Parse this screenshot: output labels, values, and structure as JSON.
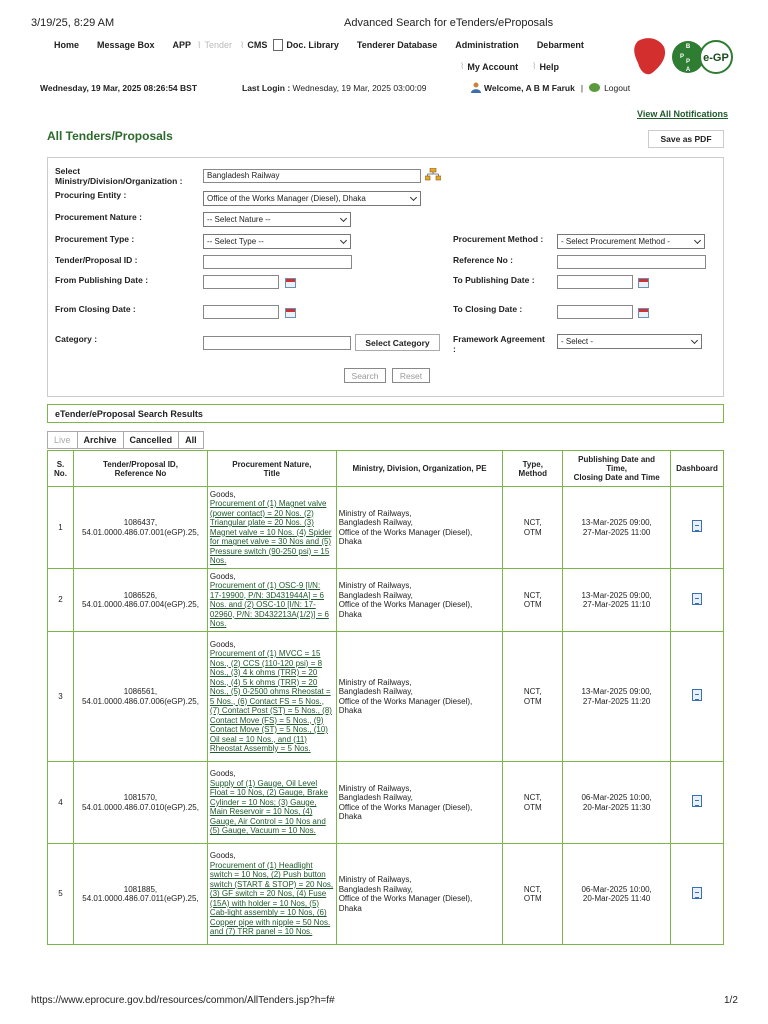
{
  "print": {
    "date": "3/19/25, 8:29 AM",
    "title": "Advanced Search for eTenders/eProposals",
    "url": "https://www.eprocure.gov.bd/resources/common/AllTenders.jsp?h=f#",
    "page": "1/2"
  },
  "nav": {
    "items": [
      "Home",
      "Message Box",
      "APP",
      "Tender",
      "CMS",
      "Doc. Library",
      "Tenderer Database",
      "Administration",
      "Debarment"
    ],
    "my_account": "My Account",
    "help": "Help"
  },
  "logo": {
    "text": "e-GP",
    "badge": "BPPA"
  },
  "status": {
    "datetime": "Wednesday, 19 Mar, 2025 08:26:54 BST",
    "last_login_label": "Last Login :",
    "last_login_value": "Wednesday, 19 Mar, 2025 03:00:09",
    "welcome": "Welcome, A B M Faruk",
    "logout": "Logout"
  },
  "links": {
    "view_all": "View All Notifications"
  },
  "page": {
    "title": "All Tenders/Proposals",
    "save_pdf": "Save as PDF"
  },
  "form": {
    "ministry_label_1": "Select",
    "ministry_label_2": "Ministry/Division/Organization :",
    "ministry_value": "Bangladesh Railway",
    "pe_label": "Procuring Entity :",
    "pe_value": "Office of the Works Manager (Diesel), Dhaka",
    "nature_label": "Procurement Nature :",
    "nature_value": "-- Select Nature --",
    "type_label": "Procurement Type :",
    "type_value": "-- Select Type --",
    "method_label": "Procurement Method :",
    "method_value": "- Select Procurement Method -",
    "tender_id_label": "Tender/Proposal ID :",
    "ref_label": "Reference No :",
    "from_pub_label": "From Publishing Date :",
    "to_pub_label": "To Publishing Date :",
    "from_close_label": "From Closing Date :",
    "to_close_label": "To Closing Date :",
    "category_label": "Category :",
    "select_category": "Select Category",
    "framework_label_1": "Framework Agreement",
    "framework_label_2": ":",
    "framework_value": "- Select -",
    "search": "Search",
    "reset": "Reset"
  },
  "results": {
    "title": "eTender/eProposal Search Results",
    "tabs": [
      "Live",
      "Archive",
      "Cancelled",
      "All"
    ],
    "headers": {
      "sno_1": "S.",
      "sno_2": "No.",
      "id_1": "Tender/Proposal ID,",
      "id_2": "Reference No",
      "nature_1": "Procurement Nature,",
      "nature_2": "Title",
      "ministry": "Ministry, Division, Organization, PE",
      "type_1": "Type,",
      "type_2": "Method",
      "dates_1": "Publishing Date and",
      "dates_2": "Time,",
      "dates_3": "Closing Date and Time",
      "dashboard": "Dashboard"
    },
    "rows": [
      {
        "sno": "1",
        "id": "1086437,",
        "ref": "54.01.0000.486.07.001(eGP).25,",
        "nature": "Goods,",
        "title": "Procurement of (1) Magnet valve (power contact) = 20 Nos. (2) Triangular plate = 20 Nos. (3) Magnet valve = 10 Nos. (4) Spider for magnet valve = 30 Nos and (5) Pressure switch (90-250 psi) = 15 Nos.",
        "min_1": "Ministry of Railways,",
        "min_2": "Bangladesh Railway,",
        "min_3": "Office of the Works Manager (Diesel),",
        "min_4": "Dhaka",
        "type": "NCT,",
        "method": "OTM",
        "pub": "13-Mar-2025 09:00,",
        "close": "27-Mar-2025 11:00"
      },
      {
        "sno": "2",
        "id": "1086526,",
        "ref": "54.01.0000.486.07.004(eGP).25,",
        "nature": "Goods,",
        "title": "Procurement of (1) OSC-9 [I/N: 17-19900, P/N: 3D431944A] = 6 Nos. and (2) OSC-10 [I/N: 17-02960, P/N: 3D432213A(1/2)] = 6 Nos.",
        "min_1": "Ministry of Railways,",
        "min_2": "Bangladesh Railway,",
        "min_3": "Office of the Works Manager (Diesel),",
        "min_4": "Dhaka",
        "type": "NCT,",
        "method": "OTM",
        "pub": "13-Mar-2025 09:00,",
        "close": "27-Mar-2025 11:10"
      },
      {
        "sno": "3",
        "id": "1086561,",
        "ref": "54.01.0000.486.07.006(eGP).25,",
        "nature": "Goods,",
        "title": "Procurement of (1) MVCC = 15 Nos., (2) CCS (110-120 psi) = 8 Nos., (3) 4 k ohms (TRR) = 20 Nos., (4) 5 k ohms (TRR) = 20 Nos., (5) 0-2500 ohms Rheostat = 5 Nos., (6) Contact FS = 5 Nos., (7) Contact Post (ST) = 5 Nos., (8) Contact Move (FS) = 5 Nos., (9) Contact Move (ST) = 5 Nos., (10) Oil seal = 10 Nos., and (11) Rheostat Assembly = 5 Nos.",
        "min_1": "Ministry of Railways,",
        "min_2": "Bangladesh Railway,",
        "min_3": "Office of the Works Manager (Diesel),",
        "min_4": "Dhaka",
        "type": "NCT,",
        "method": "OTM",
        "pub": "13-Mar-2025 09:00,",
        "close": "27-Mar-2025 11:20"
      },
      {
        "sno": "4",
        "id": "1081570,",
        "ref": "54.01.0000.486.07.010(eGP).25,",
        "nature": "Goods,",
        "title": "Supply of (1) Gauge, Oil Level Float = 10 Nos, (2) Gauge, Brake Cylinder = 10 Nos; (3) Gauge, Main Reservoir = 10 Nos, (4) Gauge, Air Control = 10 Nos and (5) Gauge, Vacuum = 10 Nos.",
        "min_1": "Ministry of Railways,",
        "min_2": "Bangladesh Railway,",
        "min_3": "Office of the Works Manager (Diesel),",
        "min_4": "Dhaka",
        "type": "NCT,",
        "method": "OTM",
        "pub": "06-Mar-2025 10:00,",
        "close": "20-Mar-2025 11:30"
      },
      {
        "sno": "5",
        "id": "1081885,",
        "ref": "54.01.0000.486.07.011(eGP).25,",
        "nature": "Goods,",
        "title": "Procurement of (1) Headlight switch = 10 Nos, (2) Push button switch (START & STOP) = 20 Nos, (3) GF switch = 20 Nos, (4) Fuse (15A) with holder = 10 Nos, (5) Cab-light assembly = 10 Nos, (6) Copper pipe with nipple = 50 Nos. and (7) TRR panel = 10 Nos.",
        "min_1": "Ministry of Railways,",
        "min_2": "Bangladesh Railway,",
        "min_3": "Office of the Works Manager (Diesel),",
        "min_4": "Dhaka",
        "type": "NCT,",
        "method": "OTM",
        "pub": "06-Mar-2025 10:00,",
        "close": "20-Mar-2025 11:40"
      }
    ]
  }
}
